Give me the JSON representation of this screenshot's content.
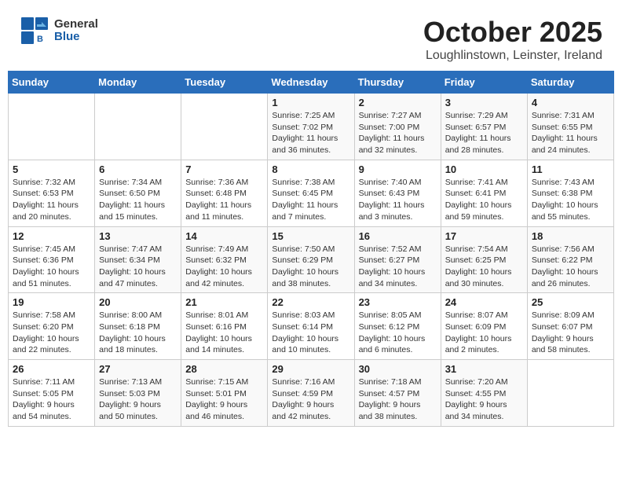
{
  "header": {
    "logo_line1": "General",
    "logo_line2": "Blue",
    "month": "October 2025",
    "location": "Loughlinstown, Leinster, Ireland"
  },
  "weekdays": [
    "Sunday",
    "Monday",
    "Tuesday",
    "Wednesday",
    "Thursday",
    "Friday",
    "Saturday"
  ],
  "weeks": [
    [
      {
        "day": "",
        "info": ""
      },
      {
        "day": "",
        "info": ""
      },
      {
        "day": "",
        "info": ""
      },
      {
        "day": "1",
        "info": "Sunrise: 7:25 AM\nSunset: 7:02 PM\nDaylight: 11 hours\nand 36 minutes."
      },
      {
        "day": "2",
        "info": "Sunrise: 7:27 AM\nSunset: 7:00 PM\nDaylight: 11 hours\nand 32 minutes."
      },
      {
        "day": "3",
        "info": "Sunrise: 7:29 AM\nSunset: 6:57 PM\nDaylight: 11 hours\nand 28 minutes."
      },
      {
        "day": "4",
        "info": "Sunrise: 7:31 AM\nSunset: 6:55 PM\nDaylight: 11 hours\nand 24 minutes."
      }
    ],
    [
      {
        "day": "5",
        "info": "Sunrise: 7:32 AM\nSunset: 6:53 PM\nDaylight: 11 hours\nand 20 minutes."
      },
      {
        "day": "6",
        "info": "Sunrise: 7:34 AM\nSunset: 6:50 PM\nDaylight: 11 hours\nand 15 minutes."
      },
      {
        "day": "7",
        "info": "Sunrise: 7:36 AM\nSunset: 6:48 PM\nDaylight: 11 hours\nand 11 minutes."
      },
      {
        "day": "8",
        "info": "Sunrise: 7:38 AM\nSunset: 6:45 PM\nDaylight: 11 hours\nand 7 minutes."
      },
      {
        "day": "9",
        "info": "Sunrise: 7:40 AM\nSunset: 6:43 PM\nDaylight: 11 hours\nand 3 minutes."
      },
      {
        "day": "10",
        "info": "Sunrise: 7:41 AM\nSunset: 6:41 PM\nDaylight: 10 hours\nand 59 minutes."
      },
      {
        "day": "11",
        "info": "Sunrise: 7:43 AM\nSunset: 6:38 PM\nDaylight: 10 hours\nand 55 minutes."
      }
    ],
    [
      {
        "day": "12",
        "info": "Sunrise: 7:45 AM\nSunset: 6:36 PM\nDaylight: 10 hours\nand 51 minutes."
      },
      {
        "day": "13",
        "info": "Sunrise: 7:47 AM\nSunset: 6:34 PM\nDaylight: 10 hours\nand 47 minutes."
      },
      {
        "day": "14",
        "info": "Sunrise: 7:49 AM\nSunset: 6:32 PM\nDaylight: 10 hours\nand 42 minutes."
      },
      {
        "day": "15",
        "info": "Sunrise: 7:50 AM\nSunset: 6:29 PM\nDaylight: 10 hours\nand 38 minutes."
      },
      {
        "day": "16",
        "info": "Sunrise: 7:52 AM\nSunset: 6:27 PM\nDaylight: 10 hours\nand 34 minutes."
      },
      {
        "day": "17",
        "info": "Sunrise: 7:54 AM\nSunset: 6:25 PM\nDaylight: 10 hours\nand 30 minutes."
      },
      {
        "day": "18",
        "info": "Sunrise: 7:56 AM\nSunset: 6:22 PM\nDaylight: 10 hours\nand 26 minutes."
      }
    ],
    [
      {
        "day": "19",
        "info": "Sunrise: 7:58 AM\nSunset: 6:20 PM\nDaylight: 10 hours\nand 22 minutes."
      },
      {
        "day": "20",
        "info": "Sunrise: 8:00 AM\nSunset: 6:18 PM\nDaylight: 10 hours\nand 18 minutes."
      },
      {
        "day": "21",
        "info": "Sunrise: 8:01 AM\nSunset: 6:16 PM\nDaylight: 10 hours\nand 14 minutes."
      },
      {
        "day": "22",
        "info": "Sunrise: 8:03 AM\nSunset: 6:14 PM\nDaylight: 10 hours\nand 10 minutes."
      },
      {
        "day": "23",
        "info": "Sunrise: 8:05 AM\nSunset: 6:12 PM\nDaylight: 10 hours\nand 6 minutes."
      },
      {
        "day": "24",
        "info": "Sunrise: 8:07 AM\nSunset: 6:09 PM\nDaylight: 10 hours\nand 2 minutes."
      },
      {
        "day": "25",
        "info": "Sunrise: 8:09 AM\nSunset: 6:07 PM\nDaylight: 9 hours\nand 58 minutes."
      }
    ],
    [
      {
        "day": "26",
        "info": "Sunrise: 7:11 AM\nSunset: 5:05 PM\nDaylight: 9 hours\nand 54 minutes."
      },
      {
        "day": "27",
        "info": "Sunrise: 7:13 AM\nSunset: 5:03 PM\nDaylight: 9 hours\nand 50 minutes."
      },
      {
        "day": "28",
        "info": "Sunrise: 7:15 AM\nSunset: 5:01 PM\nDaylight: 9 hours\nand 46 minutes."
      },
      {
        "day": "29",
        "info": "Sunrise: 7:16 AM\nSunset: 4:59 PM\nDaylight: 9 hours\nand 42 minutes."
      },
      {
        "day": "30",
        "info": "Sunrise: 7:18 AM\nSunset: 4:57 PM\nDaylight: 9 hours\nand 38 minutes."
      },
      {
        "day": "31",
        "info": "Sunrise: 7:20 AM\nSunset: 4:55 PM\nDaylight: 9 hours\nand 34 minutes."
      },
      {
        "day": "",
        "info": ""
      }
    ]
  ]
}
